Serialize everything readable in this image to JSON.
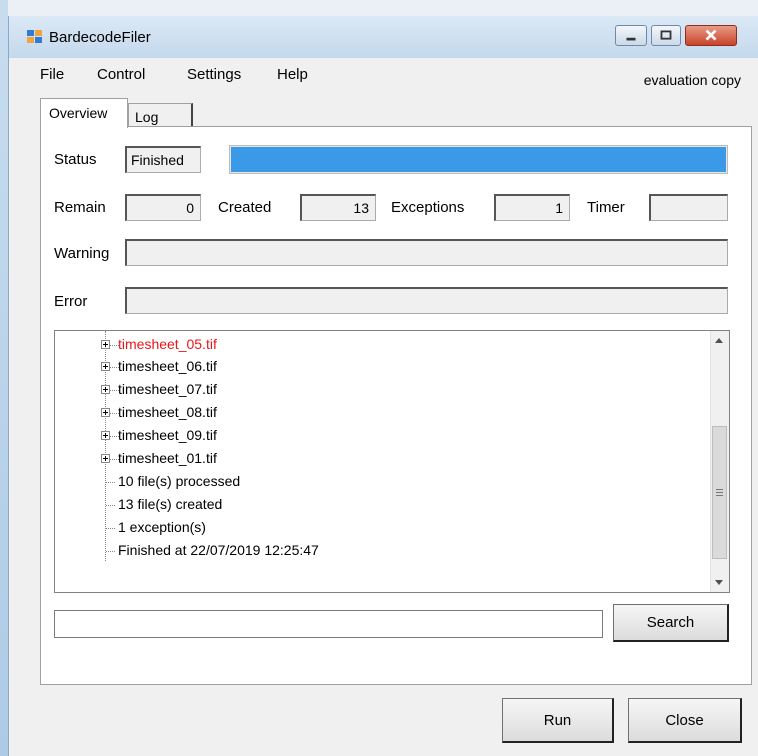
{
  "window": {
    "title": "BardecodeFiler"
  },
  "menu": {
    "items": [
      "File",
      "Control",
      "Settings",
      "Help"
    ],
    "note": "evaluation copy"
  },
  "tabs": [
    {
      "label": "Overview",
      "active": true
    },
    {
      "label": "Log",
      "active": false
    }
  ],
  "status": {
    "label": "Status",
    "value": "Finished",
    "progress_fraction": 1.0,
    "progress_color": "#3b9ae8"
  },
  "counters": {
    "remain_label": "Remain",
    "remain": "0",
    "created_label": "Created",
    "created": "13",
    "exceptions_label": "Exceptions",
    "exceptions": "1",
    "timer_label": "Timer",
    "timer": ""
  },
  "warning": {
    "label": "Warning",
    "value": ""
  },
  "error": {
    "label": "Error",
    "value": ""
  },
  "tree": {
    "files": [
      {
        "name": "timesheet_05.tif",
        "color": "#e8161b"
      },
      {
        "name": "timesheet_06.tif",
        "color": "#000000"
      },
      {
        "name": "timesheet_07.tif",
        "color": "#000000"
      },
      {
        "name": "timesheet_08.tif",
        "color": "#000000"
      },
      {
        "name": "timesheet_09.tif",
        "color": "#000000"
      },
      {
        "name": "timesheet_01.tif",
        "color": "#000000"
      }
    ],
    "summary": [
      "10 file(s) processed",
      "13 file(s) created",
      "1 exception(s)",
      "Finished at 22/07/2019 12:25:47"
    ]
  },
  "search": {
    "value": "",
    "button_label": "Search"
  },
  "footer": {
    "run_label": "Run",
    "close_label": "Close"
  }
}
